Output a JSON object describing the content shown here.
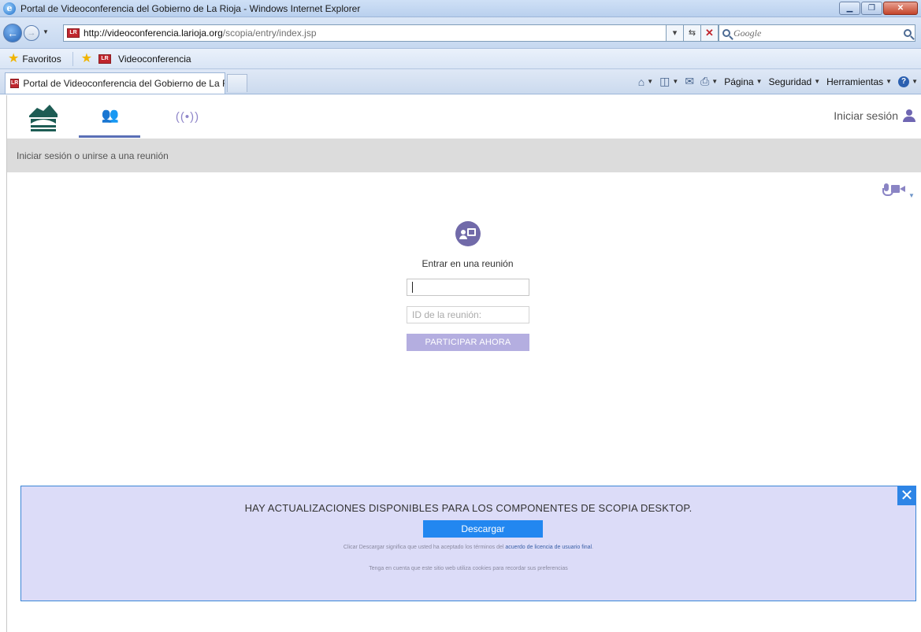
{
  "window": {
    "title": "Portal de Videoconferencia del Gobierno de La Rioja - Windows Internet Explorer"
  },
  "address_bar": {
    "url_host": "http://videoconferencia.larioja.org",
    "url_path": "/scopia/entry/index.jsp",
    "search_placeholder": "Google"
  },
  "favorites_bar": {
    "favorites_label": "Favoritos",
    "items": [
      {
        "label": "Videoconferencia"
      }
    ]
  },
  "tabs": [
    {
      "label": "Portal de Videoconferencia del Gobierno de La Ri..."
    }
  ],
  "command_bar": {
    "page": "Página",
    "security": "Seguridad",
    "tools": "Herramientas"
  },
  "app": {
    "login_label": "Iniciar sesión",
    "breadcrumb": "Iniciar sesión o unirse a una reunión",
    "join": {
      "title": "Entrar en una reunión",
      "name_value": "",
      "meeting_id_placeholder": "ID de la reunión:",
      "join_button": "PARTICIPAR AHORA"
    },
    "banner": {
      "title": "HAY ACTUALIZACIONES DISPONIBLES PARA LOS COMPONENTES DE SCOPIA DESKTOP.",
      "download_button": "Descargar",
      "terms_text": "Clicar Descargar significa que usted ha aceptado los términos del ",
      "terms_link": "acuerdo de licencia de usuario final",
      "terms_end": ".",
      "cookies_text": "Tenga en cuenta que este sitio web utiliza cookies para recordar sus preferencias",
      "close_symbol": "✕"
    }
  },
  "colors": {
    "accent_purple": "#716aa9",
    "banner_blue": "#2287f0",
    "banner_bg": "#dcdcf8",
    "join_button_disabled": "#b4aee0"
  },
  "icons": [
    "ie-logo",
    "back-arrow-icon",
    "forward-arrow-icon",
    "favorites-star-icon",
    "home-icon",
    "rss-icon",
    "mail-icon",
    "print-icon",
    "help-icon",
    "la-rioja-logo",
    "participants-icon",
    "broadcast-icon",
    "user-icon",
    "microphone-icon",
    "camera-icon",
    "join-meeting-icon",
    "close-icon"
  ]
}
